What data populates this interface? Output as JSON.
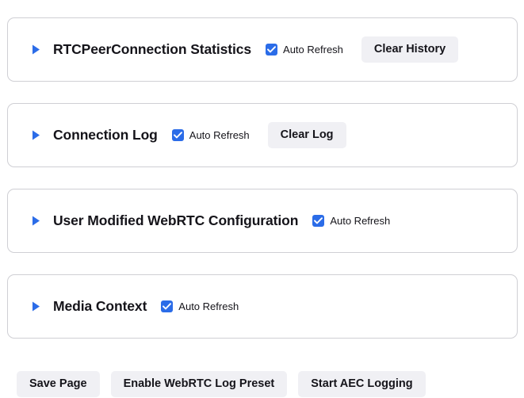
{
  "theme": {
    "accent_blue": "#2b6ce8",
    "panel_border": "#cfcfd4",
    "button_bg": "#f0f0f4",
    "text": "#15141a",
    "page_bg": "#ffffff"
  },
  "panels": [
    {
      "id": "rtc-peer-connection-statistics",
      "title": "RTCPeerConnection Statistics",
      "twisty_state": "collapsed",
      "twisty_icon": "triangle-right-icon",
      "auto_refresh": {
        "label": "Auto Refresh",
        "checked": true,
        "icon": "checkmark-icon"
      },
      "action_button": {
        "id": "clear-history",
        "label": "Clear History"
      }
    },
    {
      "id": "connection-log",
      "title": "Connection Log",
      "twisty_state": "collapsed",
      "twisty_icon": "triangle-right-icon",
      "auto_refresh": {
        "label": "Auto Refresh",
        "checked": true,
        "icon": "checkmark-icon"
      },
      "action_button": {
        "id": "clear-log",
        "label": "Clear Log"
      }
    },
    {
      "id": "user-modified-webrtc-configuration",
      "title": "User Modified WebRTC Configuration",
      "twisty_state": "collapsed",
      "twisty_icon": "triangle-right-icon",
      "auto_refresh": {
        "label": "Auto Refresh",
        "checked": true,
        "icon": "checkmark-icon"
      },
      "action_button": null
    },
    {
      "id": "media-context",
      "title": "Media Context",
      "twisty_state": "collapsed",
      "twisty_icon": "triangle-right-icon",
      "auto_refresh": {
        "label": "Auto Refresh",
        "checked": true,
        "icon": "checkmark-icon"
      },
      "action_button": null
    }
  ],
  "bottom_bar": {
    "buttons": [
      {
        "id": "save-page",
        "label": "Save Page"
      },
      {
        "id": "enable-webrtc-log-preset",
        "label": "Enable WebRTC Log Preset"
      },
      {
        "id": "start-aec-logging",
        "label": "Start AEC Logging"
      }
    ]
  }
}
